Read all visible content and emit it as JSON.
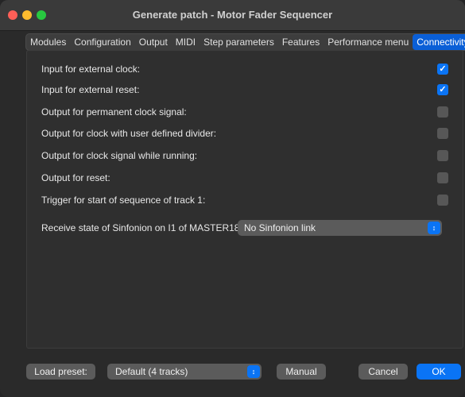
{
  "window": {
    "title": "Generate patch - Motor Fader Sequencer"
  },
  "tabs": [
    {
      "label": "Modules",
      "active": false
    },
    {
      "label": "Configuration",
      "active": false
    },
    {
      "label": "Output",
      "active": false
    },
    {
      "label": "MIDI",
      "active": false
    },
    {
      "label": "Step parameters",
      "active": false
    },
    {
      "label": "Features",
      "active": false
    },
    {
      "label": "Performance menu",
      "active": false
    },
    {
      "label": "Connectivity",
      "active": true
    }
  ],
  "options": [
    {
      "label": "Input for external clock:",
      "checked": true
    },
    {
      "label": "Input for external reset:",
      "checked": true
    },
    {
      "label": "Output for permanent clock signal:",
      "checked": false
    },
    {
      "label": "Output for clock with user defined divider:",
      "checked": false
    },
    {
      "label": "Output for clock signal while running:",
      "checked": false
    },
    {
      "label": "Output for reset:",
      "checked": false
    },
    {
      "label": "Trigger for start of sequence of track 1:",
      "checked": false
    }
  ],
  "sinfonion": {
    "label": "Receive state of Sinfonion on I1 of MASTER18:",
    "value": "No Sinfonion link"
  },
  "footer": {
    "load_preset": "Load preset:",
    "preset_value": "Default (4 tracks)",
    "manual": "Manual",
    "cancel": "Cancel",
    "ok": "OK"
  },
  "colors": {
    "accent": "#0a74f5",
    "background": "#2a2a2a"
  },
  "icons": {
    "checkmark": "checkmark-icon",
    "select_arrows": "chevron-updown-icon"
  }
}
